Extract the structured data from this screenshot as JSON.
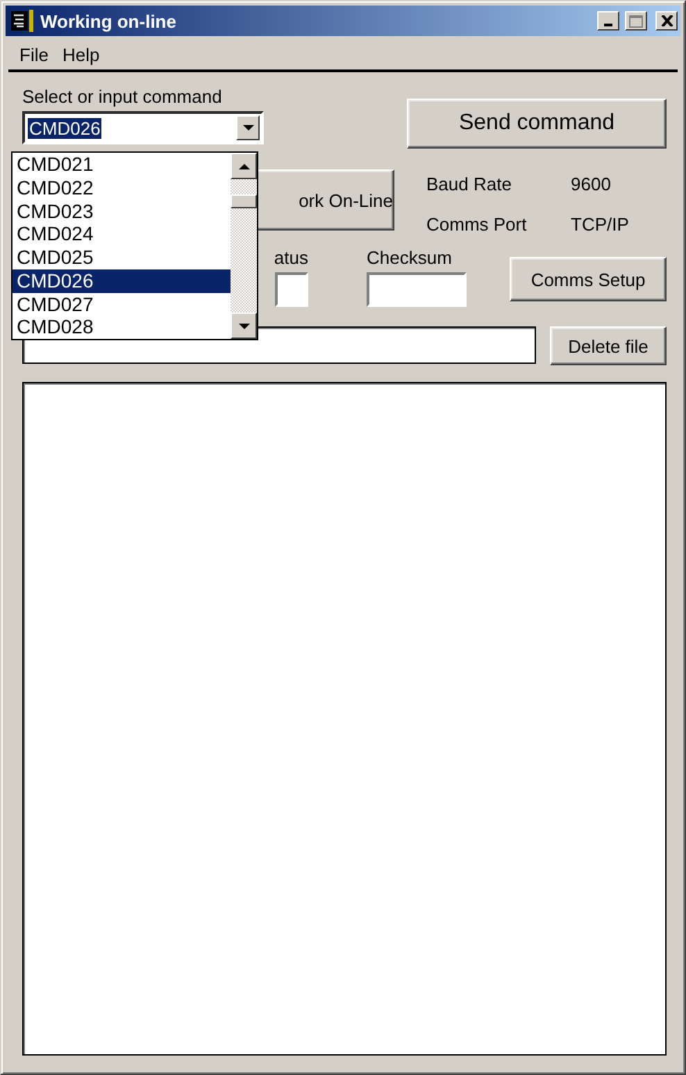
{
  "window": {
    "title": "Working on-line"
  },
  "menu": [
    "File",
    "Help"
  ],
  "command": {
    "label": "Select or input command",
    "value": "CMD026",
    "expanded": true,
    "options": [
      {
        "label": "CMD021",
        "selected": false
      },
      {
        "label": "CMD022",
        "selected": false
      },
      {
        "label": "CMD023",
        "selected": false
      },
      {
        "label": "CMD024",
        "selected": false
      },
      {
        "label": "CMD025",
        "selected": false
      },
      {
        "label": "CMD026",
        "selected": true
      },
      {
        "label": "CMD027",
        "selected": false
      },
      {
        "label": "CMD028",
        "selected": false
      }
    ]
  },
  "send_button": "Send command",
  "work_button": "ork On-Line",
  "settings": [
    {
      "label": "Baud Rate",
      "value": "9600"
    },
    {
      "label": "Comms Port",
      "value": "TCP/IP"
    }
  ],
  "status": {
    "label": "atus"
  },
  "checksum": {
    "label": "Checksum"
  },
  "comms_setup_button": "Comms Setup",
  "delete_button": "Delete file"
}
